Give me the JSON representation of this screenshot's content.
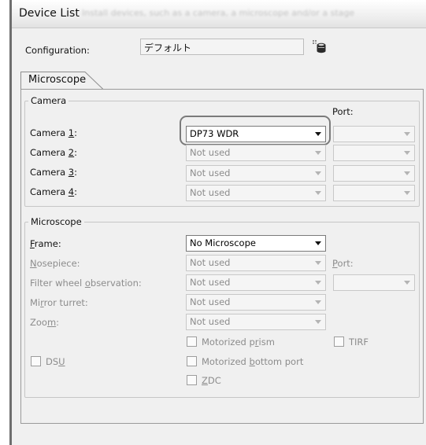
{
  "window": {
    "title": "Device List",
    "title_blurred": "Install devices, such as a camera, a microscope and/or a stage"
  },
  "configuration": {
    "label": "Configuration:",
    "value": "デフォルト",
    "icon": "database-icon"
  },
  "tabs": [
    {
      "label": "Microscope",
      "selected": true
    }
  ],
  "camera": {
    "group_title": "Camera",
    "port_header": "Port:",
    "rows": [
      {
        "label_pre": "Camera ",
        "label_key": "1",
        "label_post": ":",
        "value": "DP73 WDR",
        "enabled": true
      },
      {
        "label_pre": "Camera ",
        "label_key": "2",
        "label_post": ":",
        "value": "Not used",
        "enabled": false
      },
      {
        "label_pre": "Camera ",
        "label_key": "3",
        "label_post": ":",
        "value": "Not used",
        "enabled": false
      },
      {
        "label_pre": "Camera ",
        "label_key": "4",
        "label_post": ":",
        "value": "Not used",
        "enabled": false
      }
    ]
  },
  "microscope": {
    "group_title": "Microscope",
    "frame": {
      "label_key": "F",
      "label_post": "rame:",
      "value": "No Microscope"
    },
    "nosepiece": {
      "label_key": "N",
      "label_post": "osepiece:",
      "value": "Not used"
    },
    "filter_wheel": {
      "label_pre": "Filter wheel ",
      "label_key": "o",
      "label_post": "bservation:",
      "value": "Not used",
      "port_label_key": "P",
      "port_label_post": "ort:"
    },
    "mirror_turret": {
      "label_pre": "Mi",
      "label_key": "r",
      "label_post": "ror turret:",
      "value": "Not used"
    },
    "zoom": {
      "label_pre": "Zoo",
      "label_key": "m",
      "label_post": ":",
      "value": "Not used"
    },
    "checkboxes": {
      "motorized_prism": {
        "pre": "Motorized p",
        "key": "r",
        "post": "ism",
        "checked": false
      },
      "tirf": {
        "label": "TIRF",
        "checked": false
      },
      "dsu": {
        "pre": "DS",
        "key": "U",
        "post": "",
        "checked": false
      },
      "motorized_bottom_port": {
        "pre": "Motorized ",
        "key": "b",
        "post": "ottom port",
        "checked": false
      },
      "zdc": {
        "pre": "",
        "key": "Z",
        "post": "DC",
        "checked": false
      }
    }
  }
}
